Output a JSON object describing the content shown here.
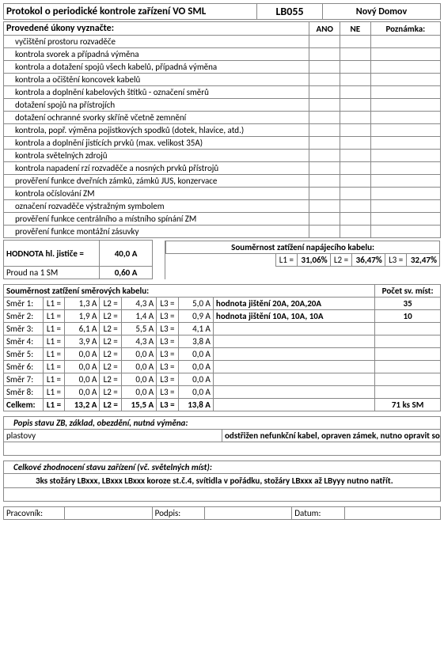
{
  "header": {
    "title": "Protokol o periodické kontrole zařízení VO SML",
    "code": "LB055",
    "place": "Nový Domov"
  },
  "tasks_header": {
    "title": "Provedené úkony vyznačte:",
    "yes": "ANO",
    "no": "NE",
    "note": "Poznámka:"
  },
  "tasks": [
    "vyčištění prostoru rozvaděče",
    "kontrola svorek a případná výměna",
    "kontrola a dotažení spojů všech kabelů, případná výměna",
    "kontrola a očištění koncovek kabelů",
    "kontrola a doplnění kabelových štítků - označení směrů",
    "dotažení spojů na přístrojích",
    "dotažení ochranné svorky skříně včetně zemnění",
    "kontrola, popř. výměna pojistkových spodků (dotek, hlavice, atd.)",
    "kontrola a doplnění jistících prvků (max. velikost 35A)",
    "kontrola světelných zdrojů",
    "kontrola napadení rzí rozvaděče a nosných prvků přístrojů",
    "prověření funkce dveřních zámků, zámků JUS, konzervace",
    "kontrola očíslování ZM",
    "označení rozvaděče výstražným symbolem",
    "prověření funkce centrálního a místního spínání ZM",
    "prověření funkce montážní zásuvky"
  ],
  "main_breaker": {
    "label": "HODNOTA hl. jističe =",
    "value": "40,0 A",
    "per_sm_label": "Proud na 1 SM",
    "per_sm_value": "0,60 A"
  },
  "symmetry_feed": {
    "title": "Souměrnost zatížení napájecího kabelu:",
    "l1lbl": "L1 =",
    "l1": "31,06%",
    "l2lbl": "L2 =",
    "l2": "36,47%",
    "l3lbl": "L3 =",
    "l3": "32,47%"
  },
  "dir_title": "Souměrnost zatížení směrových kabelu:",
  "places_title": "Počet sv. míst:",
  "dirs": [
    {
      "n": "Směr 1:",
      "l1": "1,3 A",
      "l2": "4,3 A",
      "l3": "5,0 A",
      "note": "hodnota jištění 20A, 20A,20A",
      "cnt": "35"
    },
    {
      "n": "Směr 2:",
      "l1": "1,9 A",
      "l2": "1,4 A",
      "l3": "0,9 A",
      "note": "hodnota jištění 10A, 10A, 10A",
      "cnt": "10"
    },
    {
      "n": "Směr 3:",
      "l1": "6,1 A",
      "l2": "5,5 A",
      "l3": "4,1 A",
      "note": "",
      "cnt": ""
    },
    {
      "n": "Směr 4:",
      "l1": "3,9 A",
      "l2": "4,3 A",
      "l3": "3,8 A",
      "note": "",
      "cnt": ""
    },
    {
      "n": "Směr 5:",
      "l1": "0,0 A",
      "l2": "0,0 A",
      "l3": "0,0 A",
      "note": "",
      "cnt": ""
    },
    {
      "n": "Směr 6:",
      "l1": "0,0 A",
      "l2": "0,0 A",
      "l3": "0,0 A",
      "note": "",
      "cnt": ""
    },
    {
      "n": "Směr 7:",
      "l1": "0,0 A",
      "l2": "0,0 A",
      "l3": "0,0 A",
      "note": "",
      "cnt": ""
    },
    {
      "n": "Směr 8:",
      "l1": "0,0 A",
      "l2": "0,0 A",
      "l3": "0,0 A",
      "note": "",
      "cnt": ""
    }
  ],
  "total": {
    "n": "Celkem:",
    "l1": "13,2 A",
    "l2": "15,5 A",
    "l3": "13,8 A",
    "note": "",
    "cnt": "71 ks SM"
  },
  "llabels": {
    "l1": "L1 =",
    "l2": "L2 =",
    "l3": "L3 ="
  },
  "zb": {
    "title": "Popis stavu ZB, základ, obezdění, nutná výměna:",
    "left": "plastovy",
    "text": "odstřižen nefunkční kabel, opraven zámek, nutno opravit sokl"
  },
  "overall": {
    "title": "Celkové zhodnocení stavu zařízení (vč. světelných míst):",
    "text": "3ks stožáry LBxxx, LBxxx LBxxx koroze st.č.4, svítidla v pořádku, stožáry LBxxx až LByyy nutno natřít."
  },
  "signoff": {
    "worker": "Pracovník:",
    "sign": "Podpis:",
    "date": "Datum:"
  }
}
